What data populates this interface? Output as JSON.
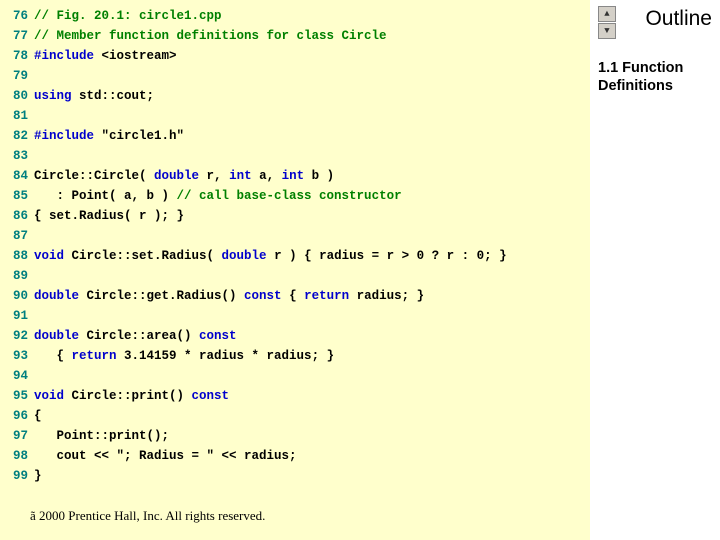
{
  "sidebar": {
    "title": "Outline",
    "subtitle": "1.1 Function Definitions"
  },
  "footer": "2000 Prentice Hall, Inc. All rights reserved.",
  "code": [
    {
      "n": "76",
      "tokens": [
        [
          "comment",
          "// Fig. 20.1: circle1.cpp"
        ]
      ]
    },
    {
      "n": "77",
      "tokens": [
        [
          "comment",
          "// Member function definitions for class Circle"
        ]
      ]
    },
    {
      "n": "78",
      "tokens": [
        [
          "kw",
          "#include "
        ],
        [
          "plain",
          "<iostream>"
        ]
      ]
    },
    {
      "n": "79",
      "tokens": []
    },
    {
      "n": "80",
      "tokens": [
        [
          "kw",
          "using"
        ],
        [
          "plain",
          " std::cout;"
        ]
      ]
    },
    {
      "n": "81",
      "tokens": []
    },
    {
      "n": "82",
      "tokens": [
        [
          "kw",
          "#include "
        ],
        [
          "plain",
          "\"circle1.h\""
        ]
      ]
    },
    {
      "n": "83",
      "tokens": []
    },
    {
      "n": "84",
      "tokens": [
        [
          "plain",
          "Circle::Circle( "
        ],
        [
          "kw",
          "double"
        ],
        [
          "plain",
          " r, "
        ],
        [
          "kw",
          "int"
        ],
        [
          "plain",
          " a, "
        ],
        [
          "kw",
          "int"
        ],
        [
          "plain",
          " b )"
        ]
      ]
    },
    {
      "n": "85",
      "tokens": [
        [
          "plain",
          "   : Point( a, b ) "
        ],
        [
          "comment",
          "// call base-class constructor"
        ]
      ]
    },
    {
      "n": "86",
      "tokens": [
        [
          "plain",
          "{ set.Radius( r ); }"
        ]
      ]
    },
    {
      "n": "87",
      "tokens": []
    },
    {
      "n": "88",
      "tokens": [
        [
          "kw",
          "void"
        ],
        [
          "plain",
          " Circle::set.Radius( "
        ],
        [
          "kw",
          "double"
        ],
        [
          "plain",
          " r ) { radius = r > 0 ? r : 0; }"
        ]
      ]
    },
    {
      "n": "89",
      "tokens": []
    },
    {
      "n": "90",
      "tokens": [
        [
          "kw",
          "double"
        ],
        [
          "plain",
          " Circle::get.Radius() "
        ],
        [
          "kw",
          "const"
        ],
        [
          "plain",
          " { "
        ],
        [
          "kw",
          "return"
        ],
        [
          "plain",
          " radius; }"
        ]
      ]
    },
    {
      "n": "91",
      "tokens": []
    },
    {
      "n": "92",
      "tokens": [
        [
          "kw",
          "double"
        ],
        [
          "plain",
          " Circle::area() "
        ],
        [
          "kw",
          "const"
        ]
      ]
    },
    {
      "n": "93",
      "tokens": [
        [
          "plain",
          "   { "
        ],
        [
          "kw",
          "return"
        ],
        [
          "plain",
          " 3.14159 * radius * radius; }"
        ]
      ]
    },
    {
      "n": "94",
      "tokens": []
    },
    {
      "n": "95",
      "tokens": [
        [
          "kw",
          "void"
        ],
        [
          "plain",
          " Circle::print() "
        ],
        [
          "kw",
          "const"
        ]
      ]
    },
    {
      "n": "96",
      "tokens": [
        [
          "plain",
          "{"
        ]
      ]
    },
    {
      "n": "97",
      "tokens": [
        [
          "plain",
          "   Point::print();"
        ]
      ]
    },
    {
      "n": "98",
      "tokens": [
        [
          "plain",
          "   cout << \"; Radius = \" << radius;"
        ]
      ]
    },
    {
      "n": "99",
      "tokens": [
        [
          "plain",
          "}"
        ]
      ]
    }
  ]
}
